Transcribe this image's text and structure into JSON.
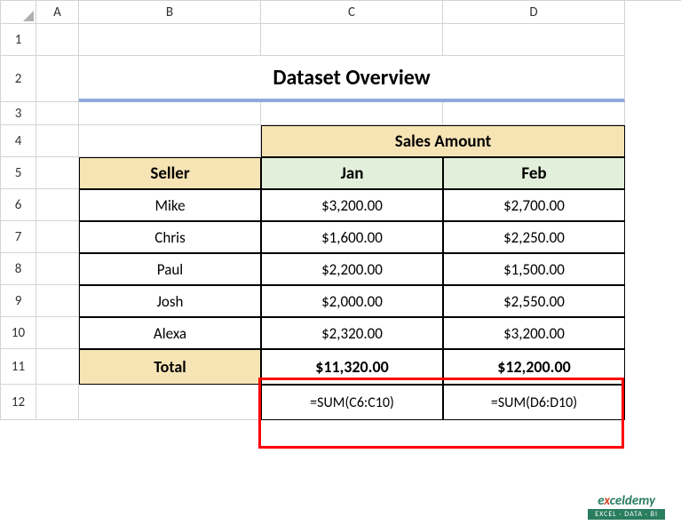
{
  "cols": [
    "A",
    "B",
    "C",
    "D"
  ],
  "rows": [
    "1",
    "2",
    "3",
    "4",
    "5",
    "6",
    "7",
    "8",
    "9",
    "10",
    "11",
    "12"
  ],
  "title": "Dataset Overview",
  "salesHeader": "Sales Amount",
  "sellerHeader": "Seller",
  "months": {
    "c": "Jan",
    "d": "Feb"
  },
  "data": [
    {
      "name": "Mike",
      "jan": "$3,200.00",
      "feb": "$2,700.00"
    },
    {
      "name": "Chris",
      "jan": "$1,600.00",
      "feb": "$2,250.00"
    },
    {
      "name": "Paul",
      "jan": "$2,200.00",
      "feb": "$1,500.00"
    },
    {
      "name": "Josh",
      "jan": "$2,000.00",
      "feb": "$2,550.00"
    },
    {
      "name": "Alexa",
      "jan": "$2,320.00",
      "feb": "$3,200.00"
    }
  ],
  "totalLabel": "Total",
  "totals": {
    "jan": "$11,320.00",
    "feb": "$12,200.00"
  },
  "formulas": {
    "jan": "=SUM(C6:C10)",
    "feb": "=SUM(D6:D10)"
  },
  "wm": {
    "brand1": "e",
    "brand2": "x",
    "brand3": "celdemy",
    "slogan": "EXCEL · DATA · BI"
  },
  "chart_data": {
    "type": "table",
    "title": "Dataset Overview",
    "columns": [
      "Seller",
      "Jan",
      "Feb"
    ],
    "rows": [
      [
        "Mike",
        3200.0,
        2700.0
      ],
      [
        "Chris",
        1600.0,
        2250.0
      ],
      [
        "Paul",
        2200.0,
        1500.0
      ],
      [
        "Josh",
        2000.0,
        2550.0
      ],
      [
        "Alexa",
        2320.0,
        3200.0
      ]
    ],
    "totals": {
      "Jan": 11320.0,
      "Feb": 12200.0
    },
    "formulas": {
      "Jan": "=SUM(C6:C10)",
      "Feb": "=SUM(D6:D10)"
    }
  }
}
